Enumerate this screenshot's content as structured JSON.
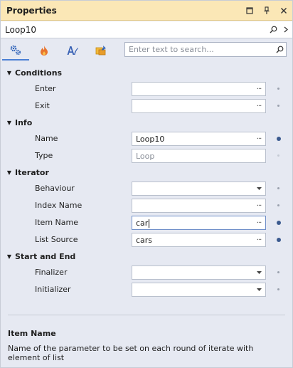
{
  "window": {
    "title": "Properties"
  },
  "object": {
    "name": "Loop10"
  },
  "toolbar": {
    "tabs": [
      {
        "icon": "gears-icon",
        "active": true
      },
      {
        "icon": "flame-icon",
        "active": false
      },
      {
        "icon": "text-style-icon",
        "active": false
      },
      {
        "icon": "cube-pin-icon",
        "active": false
      }
    ],
    "search_placeholder": "Enter text to search..."
  },
  "categories": [
    {
      "name": "Conditions",
      "props": [
        {
          "label": "Enter",
          "value": "",
          "editor": "ellipsis",
          "modified": false
        },
        {
          "label": "Exit",
          "value": "",
          "editor": "ellipsis",
          "modified": false
        }
      ]
    },
    {
      "name": "Info",
      "props": [
        {
          "label": "Name",
          "value": "Loop10",
          "editor": "ellipsis",
          "modified": true
        },
        {
          "label": "Type",
          "value": "Loop",
          "editor": "readonly",
          "modified": false
        }
      ]
    },
    {
      "name": "Iterator",
      "props": [
        {
          "label": "Behaviour",
          "value": "",
          "editor": "dropdown",
          "modified": false
        },
        {
          "label": "Index Name",
          "value": "",
          "editor": "ellipsis",
          "modified": false
        },
        {
          "label": "Item Name",
          "value": "car",
          "editor": "ellipsis",
          "modified": true,
          "focused": true
        },
        {
          "label": "List Source",
          "value": "cars",
          "editor": "ellipsis",
          "modified": true
        }
      ]
    },
    {
      "name": "Start and End",
      "props": [
        {
          "label": "Finalizer",
          "value": "",
          "editor": "dropdown",
          "modified": false
        },
        {
          "label": "Initializer",
          "value": "",
          "editor": "dropdown",
          "modified": false
        }
      ]
    }
  ],
  "description": {
    "title": "Item Name",
    "text": "Name of the parameter to be set on each round of iterate with element of list"
  }
}
